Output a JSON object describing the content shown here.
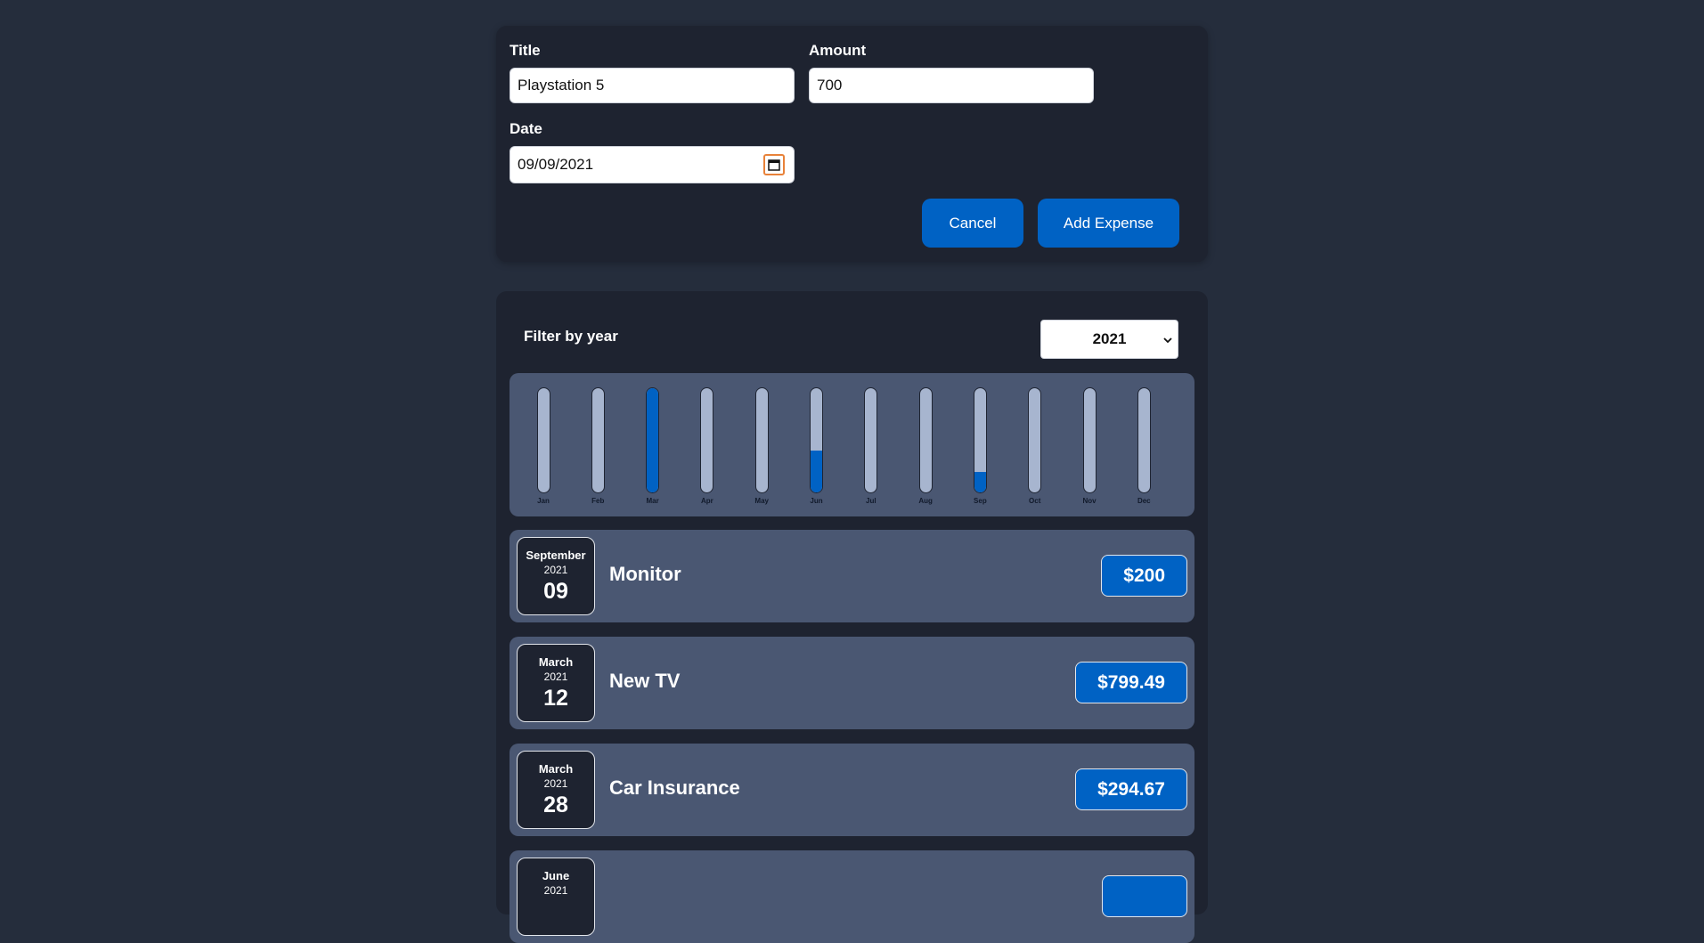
{
  "form": {
    "title_label": "Title",
    "title_value": "Playstation 5",
    "amount_label": "Amount",
    "amount_value": "700",
    "date_label": "Date",
    "date_value": "09/09/2021",
    "cancel_label": "Cancel",
    "add_label": "Add Expense"
  },
  "filter": {
    "label": "Filter by year",
    "selected_year": "2021"
  },
  "chart_data": {
    "type": "bar",
    "categories": [
      "Jan",
      "Feb",
      "Mar",
      "Apr",
      "May",
      "Jun",
      "Jul",
      "Aug",
      "Sep",
      "Oct",
      "Nov",
      "Dec"
    ],
    "values": [
      0,
      0,
      1.0,
      0,
      0,
      0.4,
      0,
      0,
      0.2,
      0,
      0,
      0
    ],
    "ylim": [
      0,
      1
    ],
    "colors": {
      "fill": "#0062c4",
      "track": "#a7b5cf"
    }
  },
  "expenses": [
    {
      "month": "September",
      "year": "2021",
      "day": "09",
      "title": "Monitor",
      "price": "$200"
    },
    {
      "month": "March",
      "year": "2021",
      "day": "12",
      "title": "New TV",
      "price": "$799.49"
    },
    {
      "month": "March",
      "year": "2021",
      "day": "28",
      "title": "Car Insurance",
      "price": "$294.67"
    },
    {
      "month": "June",
      "year": "2021",
      "day": "",
      "title": "",
      "price": ""
    }
  ],
  "colors": {
    "accent": "#0062c4",
    "background": "#252d3c",
    "card": "#1e2330",
    "item": "#4a5772"
  }
}
